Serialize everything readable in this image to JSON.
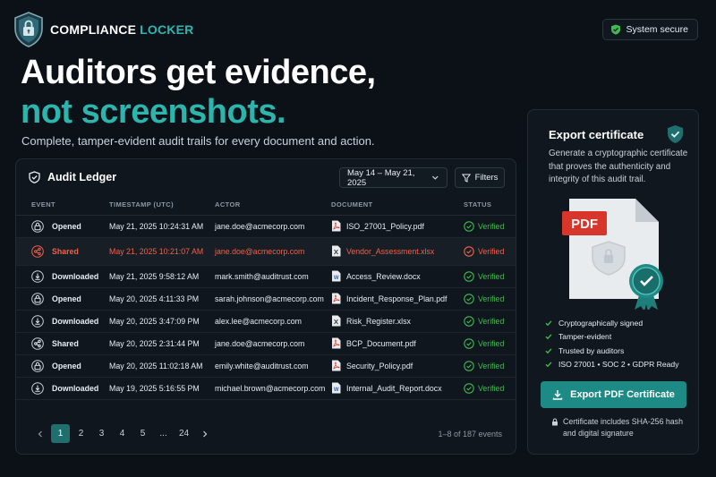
{
  "brand": {
    "name_white": "COMPLIANCE",
    "name_teal": "LOCKER"
  },
  "status_pill": {
    "label": "System secure"
  },
  "hero": {
    "line1": "Auditors get evidence,",
    "line2": "not screenshots.",
    "subtitle": "Complete, tamper-evident audit trails for every document and action."
  },
  "ledger": {
    "title": "Audit Ledger",
    "date_range": "May 14 – May 21, 2025",
    "filters_label": "Filters",
    "columns": [
      "EVENT",
      "TIMESTAMP (UTC)",
      "ACTOR",
      "DOCUMENT",
      "STATUS"
    ],
    "rows": [
      {
        "event": "Opened",
        "icon": "lock-icon",
        "timestamp": "May 21, 2025 10:24:31 AM",
        "actor": "jane.doe@acmecorp.com",
        "document": "ISO_27001_Policy.pdf",
        "doc_type": "pdf",
        "status": "Verified"
      },
      {
        "event": "Shared",
        "icon": "share-icon",
        "timestamp": "May 21, 2025 10:21:07 AM",
        "actor": "jane.doe@acmecorp.com",
        "document": "Vendor_Assessment.xlsx",
        "doc_type": "xlsx",
        "status": "Verified",
        "highlight": true
      },
      {
        "event": "Downloaded",
        "icon": "download-icon",
        "timestamp": "May 21, 2025 9:58:12 AM",
        "actor": "mark.smith@auditrust.com",
        "document": "Access_Review.docx",
        "doc_type": "docx",
        "status": "Verified"
      },
      {
        "event": "Opened",
        "icon": "lock-icon",
        "timestamp": "May 20, 2025 4:11:33 PM",
        "actor": "sarah.johnson@acmecorp.com",
        "document": "Incident_Response_Plan.pdf",
        "doc_type": "pdf",
        "status": "Verified"
      },
      {
        "event": "Downloaded",
        "icon": "download-icon",
        "timestamp": "May 20, 2025 3:47:09 PM",
        "actor": "alex.lee@acmecorp.com",
        "document": "Risk_Register.xlsx",
        "doc_type": "xlsx",
        "status": "Verified"
      },
      {
        "event": "Shared",
        "icon": "share-icon",
        "timestamp": "May 20, 2025 2:31:44 PM",
        "actor": "jane.doe@acmecorp.com",
        "document": "BCP_Document.pdf",
        "doc_type": "pdf",
        "status": "Verified"
      },
      {
        "event": "Opened",
        "icon": "lock-icon",
        "timestamp": "May 20, 2025 11:02:18 AM",
        "actor": "emily.white@auditrust.com",
        "document": "Security_Policy.pdf",
        "doc_type": "pdf",
        "status": "Verified"
      },
      {
        "event": "Downloaded",
        "icon": "download-icon",
        "timestamp": "May 19, 2025 5:16:55 PM",
        "actor": "michael.brown@acmecorp.com",
        "document": "Internal_Audit_Report.docx",
        "doc_type": "docx",
        "status": "Verified"
      }
    ],
    "pagination": {
      "pages": [
        "1",
        "2",
        "3",
        "4",
        "5",
        "...",
        "24"
      ],
      "current": "1",
      "info": "1–8 of 187 events"
    }
  },
  "export": {
    "title": "Export certificate",
    "description": "Generate a cryptographic certificate that proves the authenticity and integrity of this audit trail.",
    "file_label": "PDF",
    "features": [
      "Cryptographically signed",
      "Tamper-evident",
      "Trusted by auditors",
      "ISO 27001 • SOC 2 • GDPR Ready"
    ],
    "button_label": "Export PDF Certificate",
    "note_line1": "Certificate includes SHA-256 hash",
    "note_line2": "and digital signature"
  },
  "colors": {
    "teal": "#2bb5ad",
    "verified_green": "#3fb950",
    "alert_red": "#f0604a",
    "pdf_red": "#d9362b",
    "button_teal": "#1e8a85"
  }
}
